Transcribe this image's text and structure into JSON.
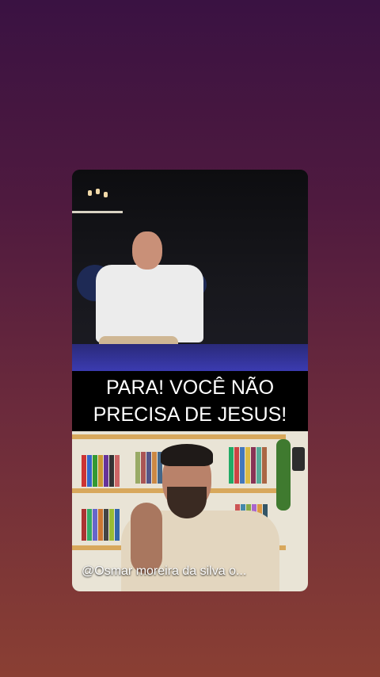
{
  "caption": {
    "line1": "PARA! VOCÊ NÃO",
    "line2": "PRECISA DE JESUS!"
  },
  "channel": {
    "handle": "@Osmar moreira da silva o..."
  },
  "colors": {
    "background_top": "#3a1242",
    "background_bottom": "#8a3f33",
    "caption_background": "#000000",
    "caption_text": "#ffffff"
  }
}
